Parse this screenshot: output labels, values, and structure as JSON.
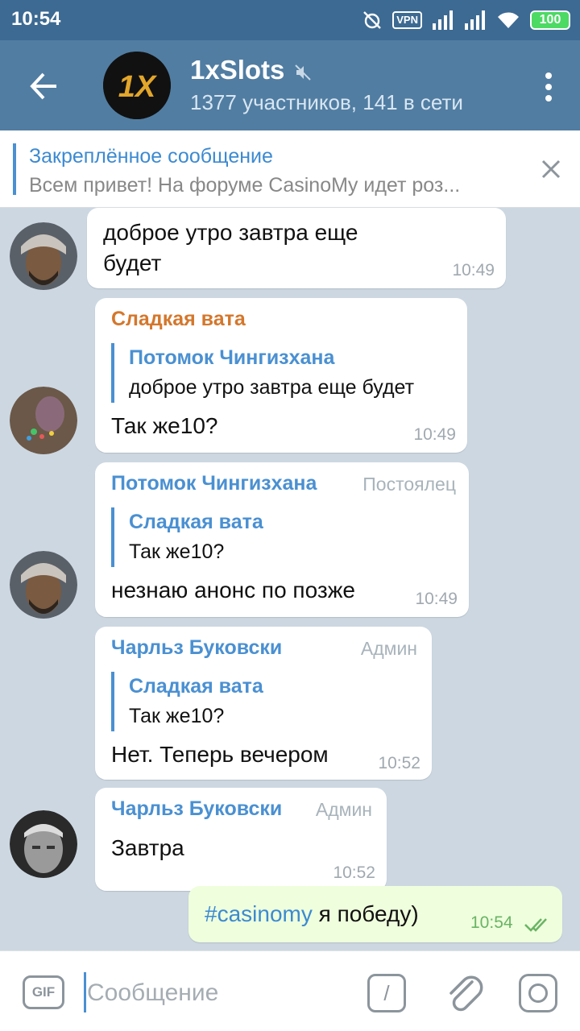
{
  "status_bar": {
    "time": "10:54",
    "vpn": "VPN",
    "battery": "100"
  },
  "header": {
    "title": "1xSlots",
    "subtitle": "1377 участников, 141 в сети",
    "avatar_text": "1X"
  },
  "pinned": {
    "title": "Закреплённое сообщение",
    "text": "Всем привет! На форуме CasinoMy идет роз..."
  },
  "messages": [
    {
      "text_line1": "доброе утро  завтра еще",
      "text_line2": "будет",
      "time": "10:49"
    },
    {
      "sender": "Сладкая вата",
      "sender_color": "#d4772c",
      "reply_name": "Потомок Чингизхана",
      "reply_text": "доброе утро  завтра еще будет",
      "text": "Так же10?",
      "time": "10:49"
    },
    {
      "sender": "Потомок Чингизхана",
      "sender_color": "#4a90d2",
      "role": "Постоялец",
      "reply_name": "Сладкая вата",
      "reply_text": "Так же10?",
      "text": "незнаю анонс по позже",
      "time": "10:49"
    },
    {
      "sender": "Чарльз Буковски",
      "sender_color": "#4a90d2",
      "role": "Админ",
      "reply_name": "Сладкая вата",
      "reply_text": "Так же10?",
      "text": "Нет. Теперь вечером",
      "time": "10:52"
    },
    {
      "sender": "Чарльз Буковски",
      "sender_color": "#4a90d2",
      "role": "Админ",
      "text": "Завтра",
      "time": "10:52"
    },
    {
      "hashtag": "#casinomy",
      "text": " я победу)",
      "time": "10:54"
    }
  ],
  "composer": {
    "gif_label": "GIF",
    "placeholder": "Сообщение",
    "cmd_label": "/"
  },
  "icons": {
    "back": "arrow-left-icon",
    "mute": "muted-speaker-icon",
    "menu": "more-vertical-icon",
    "close": "close-icon",
    "attach": "paperclip-icon",
    "camera": "camera-icon",
    "read": "double-check-icon"
  },
  "colors": {
    "header": "#517da2",
    "status_bar": "#3d6a92",
    "accent": "#4a90d2",
    "outgoing_bubble": "#effedd",
    "chat_bg": "#ccd7e1"
  }
}
